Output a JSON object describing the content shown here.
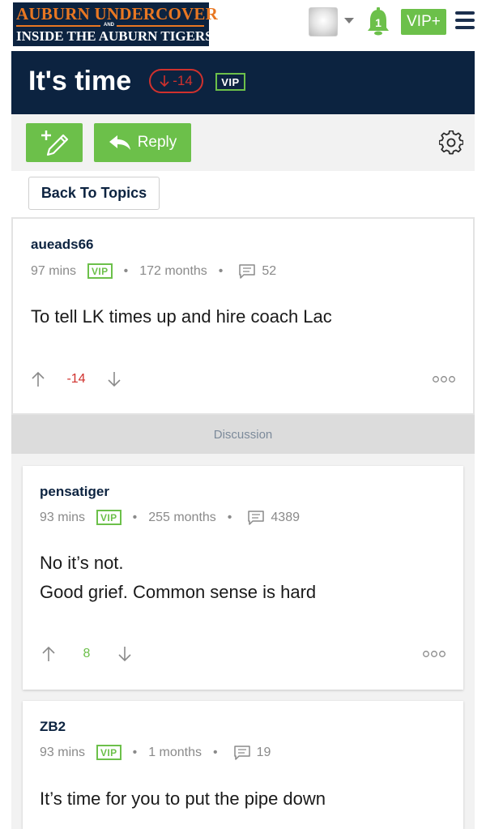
{
  "header": {
    "logo_top": "AUBURN UNDERCOVER",
    "logo_and": "AND",
    "logo_bottom": "INSIDE THE AUBURN TIGERS",
    "notification_count": "1",
    "vip_plus_label": "VIP+",
    "icons": [
      "user-avatar",
      "caret-down-icon",
      "bell-icon",
      "hamburger-menu-icon"
    ]
  },
  "topic": {
    "title": "It's time",
    "score": "-14",
    "vip_label": "VIP"
  },
  "toolbar": {
    "reply_label": "Reply",
    "icons": [
      "new-post-icon",
      "reply-arrow-icon",
      "gear-icon"
    ]
  },
  "back_to_topics_label": "Back To Topics",
  "discussion_label": "Discussion",
  "posts": [
    {
      "author": "aueads66",
      "time": "97 mins",
      "vip": "VIP",
      "tenure": "172 months",
      "post_count": "52",
      "body_lines": [
        "To tell LK times up and hire coach Lac"
      ],
      "votes": "-14"
    },
    {
      "author": "pensatiger",
      "time": "93 mins",
      "vip": "VIP",
      "tenure": "255 months",
      "post_count": "4389",
      "body_lines": [
        "No it’s not.",
        "Good grief. Common sense is hard"
      ],
      "votes": "8"
    },
    {
      "author": "ZB2",
      "time": "93 mins",
      "vip": "VIP",
      "tenure": "1 months",
      "post_count": "19",
      "body_lines": [
        "It’s time for you to put the pipe down"
      ]
    }
  ],
  "colors": {
    "navy": "#0c2340",
    "orange": "#e87722",
    "green": "#6cc04a",
    "red": "#d0312d"
  }
}
